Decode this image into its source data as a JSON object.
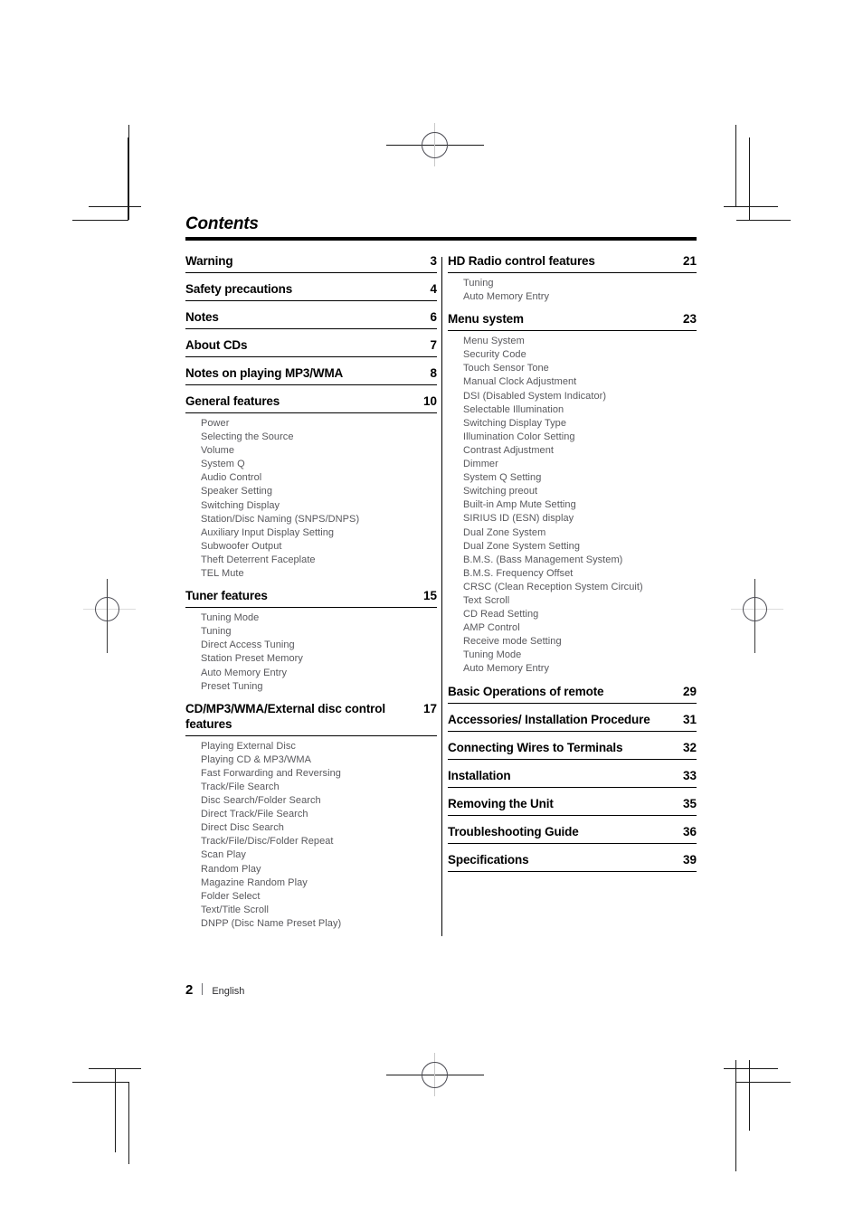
{
  "document": {
    "title": "Contents",
    "footer": {
      "page_number": "2",
      "language": "English"
    }
  },
  "left_column": [
    {
      "title": "Warning",
      "page": "3",
      "subitems": []
    },
    {
      "title": "Safety precautions",
      "page": "4",
      "subitems": []
    },
    {
      "title": "Notes",
      "page": "6",
      "subitems": []
    },
    {
      "title": "About CDs",
      "page": "7",
      "subitems": []
    },
    {
      "title": "Notes on playing MP3/WMA",
      "page": "8",
      "subitems": []
    },
    {
      "title": "General features",
      "page": "10",
      "subitems": [
        "Power",
        "Selecting the Source",
        "Volume",
        "System Q",
        "Audio Control",
        "Speaker Setting",
        "Switching Display",
        "Station/Disc Naming (SNPS/DNPS)",
        "Auxiliary Input Display Setting",
        "Subwoofer Output",
        "Theft Deterrent Faceplate",
        "TEL Mute"
      ]
    },
    {
      "title": "Tuner features",
      "page": "15",
      "subitems": [
        "Tuning Mode",
        "Tuning",
        "Direct Access Tuning",
        "Station Preset Memory",
        "Auto Memory Entry",
        "Preset Tuning"
      ]
    },
    {
      "title": "CD/MP3/WMA/External disc control features",
      "page": "17",
      "subitems": [
        "Playing External Disc",
        "Playing CD & MP3/WMA",
        "Fast Forwarding and Reversing",
        "Track/File Search",
        "Disc Search/Folder Search",
        "Direct Track/File Search",
        "Direct Disc Search",
        "Track/File/Disc/Folder Repeat",
        "Scan Play",
        "Random Play",
        "Magazine Random Play",
        "Folder Select",
        "Text/Title Scroll",
        "DNPP (Disc Name Preset Play)"
      ]
    }
  ],
  "right_column": [
    {
      "title": "HD Radio control features",
      "page": "21",
      "subitems": [
        "Tuning",
        "Auto Memory Entry"
      ]
    },
    {
      "title": "Menu system",
      "page": "23",
      "subitems": [
        "Menu System",
        "Security Code",
        "Touch Sensor Tone",
        "Manual Clock Adjustment",
        "DSI (Disabled System Indicator)",
        "Selectable Illumination",
        "Switching Display Type",
        "Illumination Color Setting",
        "Contrast Adjustment",
        "Dimmer",
        "System Q Setting",
        "Switching preout",
        "Built-in Amp Mute Setting",
        "SIRIUS ID (ESN) display",
        "Dual Zone System",
        "Dual Zone System Setting",
        "B.M.S. (Bass Management System)",
        "B.M.S. Frequency Offset",
        "CRSC (Clean Reception System Circuit)",
        "Text Scroll",
        "CD Read Setting",
        "AMP Control",
        "Receive mode Setting",
        "Tuning Mode",
        "Auto Memory Entry"
      ]
    },
    {
      "title": "Basic Operations of remote",
      "page": "29",
      "subitems": []
    },
    {
      "title": "Accessories/ Installation Procedure",
      "page": "31",
      "subitems": []
    },
    {
      "title": "Connecting Wires to Terminals",
      "page": "32",
      "subitems": []
    },
    {
      "title": "Installation",
      "page": "33",
      "subitems": []
    },
    {
      "title": "Removing the Unit",
      "page": "35",
      "subitems": []
    },
    {
      "title": "Troubleshooting Guide",
      "page": "36",
      "subitems": []
    },
    {
      "title": "Specifications",
      "page": "39",
      "subitems": []
    }
  ]
}
